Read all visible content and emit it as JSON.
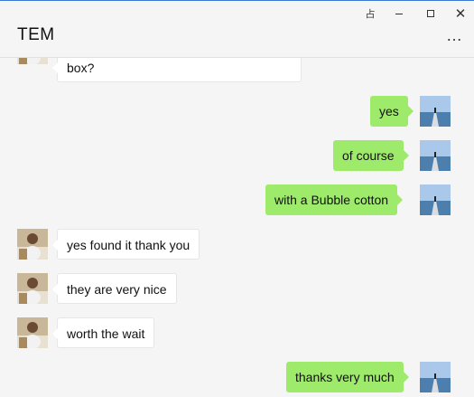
{
  "window": {
    "title": "TEM",
    "pin_glyph": "占",
    "close_glyph": "✕",
    "more_glyph": "…"
  },
  "messages": [
    {
      "side": "in",
      "text": "box?"
    },
    {
      "side": "out",
      "text": "yes"
    },
    {
      "side": "out",
      "text": "of course"
    },
    {
      "side": "out",
      "text": "with a Bubble cotton"
    },
    {
      "side": "in",
      "text": "yes found it thank you"
    },
    {
      "side": "in",
      "text": "they are very nice"
    },
    {
      "side": "in",
      "text": "worth the wait"
    },
    {
      "side": "out",
      "text": "thanks very much"
    }
  ],
  "colors": {
    "outgoing_bubble": "#9eea6a",
    "incoming_bubble": "#ffffff",
    "background": "#f5f5f5"
  },
  "icons": {
    "contact_avatar": "person-photo-avatar",
    "self_avatar": "sea-pier-avatar",
    "pin": "pin-icon",
    "minimize": "minimize-icon",
    "maximize": "maximize-icon",
    "close": "close-icon",
    "more": "more-icon"
  }
}
